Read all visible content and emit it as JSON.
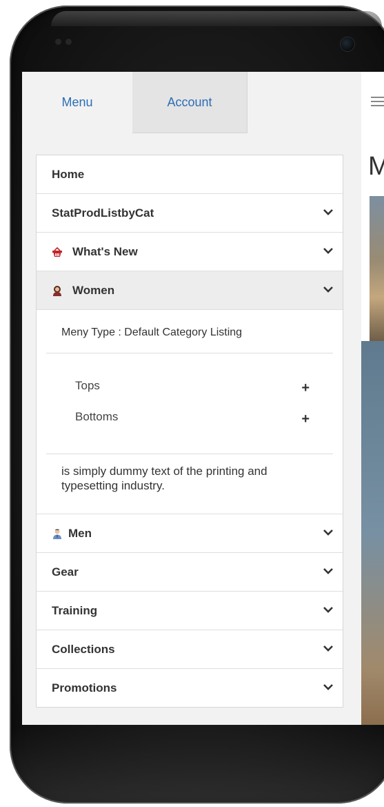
{
  "tabs": {
    "menu": "Menu",
    "account": "Account"
  },
  "menu_items": {
    "home": "Home",
    "stat": "StatProdListbyCat",
    "whats_new": "What's New",
    "women": "Women",
    "men": "Men",
    "gear": "Gear",
    "training": "Training",
    "collections": "Collections",
    "promotions": "Promotions"
  },
  "icons": {
    "whats_new": "basket-icon",
    "women": "woman-avatar-icon",
    "men": "man-avatar-icon",
    "chevron": "chevron-down-icon",
    "plus": "plus-icon"
  },
  "women_submenu": {
    "menu_type": "Meny Type  : Default Category Listing",
    "links": [
      {
        "label": "Tops",
        "expander": "+"
      },
      {
        "label": "Bottoms",
        "expander": "+"
      }
    ],
    "description": "is simply dummy text of the printing and typesetting industry."
  },
  "colors": {
    "tab_link": "#2c6db5",
    "basket": "#c0262d",
    "men_icon": "#6a8fc4"
  }
}
